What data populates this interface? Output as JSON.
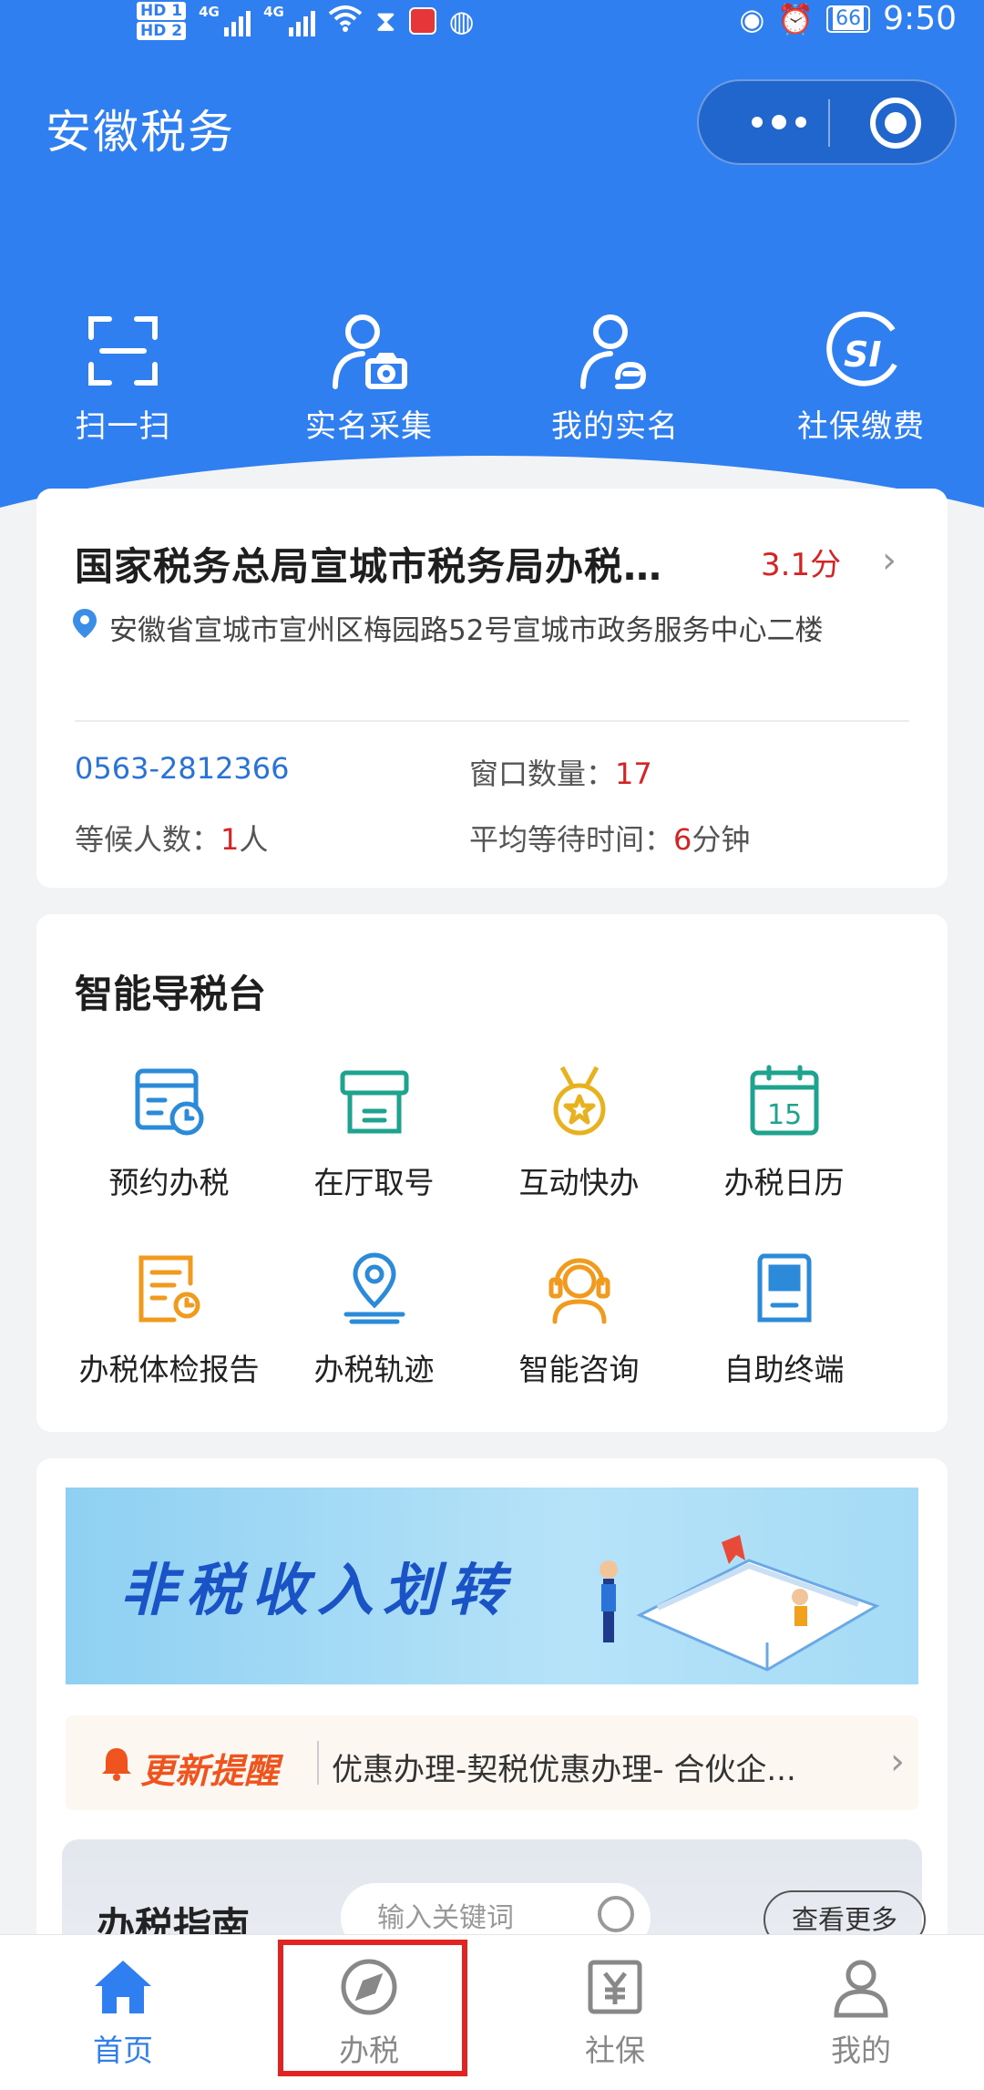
{
  "status_bar": {
    "hd1": "HD 1",
    "hd2": "HD 2",
    "net1": "4G",
    "net2": "4G",
    "battery": "66",
    "time": "9:50"
  },
  "header": {
    "title": "安徽税务"
  },
  "quick_actions": [
    {
      "label": "扫一扫",
      "icon": "scan-icon"
    },
    {
      "label": "实名采集",
      "icon": "user-camera-icon"
    },
    {
      "label": "我的实名",
      "icon": "user-id-icon"
    },
    {
      "label": "社保缴费",
      "icon": "social-security-icon"
    }
  ],
  "tax_office": {
    "name": "国家税务总局宣城市税务局办税…",
    "score": "3.1分",
    "address": "安徽省宣城市宣州区梅园路52号宣城市政务服务中心二楼",
    "phone": "0563-2812366",
    "window_label": "窗口数量：",
    "window_count": "17",
    "waiting_label": "等候人数：",
    "waiting_count": "1",
    "waiting_unit": "人",
    "avg_wait_label": "平均等待时间：",
    "avg_wait_value": "6",
    "avg_wait_unit": "分钟"
  },
  "smart_guide": {
    "title": "智能导税台",
    "items": [
      {
        "label": "预约办税",
        "icon": "calendar-clock-icon"
      },
      {
        "label": "在厅取号",
        "icon": "ticket-machine-icon"
      },
      {
        "label": "互动快办",
        "icon": "medal-icon"
      },
      {
        "label": "办税日历",
        "icon": "calendar-15-icon"
      },
      {
        "label": "办税体检报告",
        "icon": "report-icon"
      },
      {
        "label": "办税轨迹",
        "icon": "location-pin-icon"
      },
      {
        "label": "智能咨询",
        "icon": "headset-agent-icon"
      },
      {
        "label": "自助终端",
        "icon": "kiosk-icon"
      }
    ]
  },
  "banner": {
    "text": "非税收入划转"
  },
  "notice": {
    "tag": "更新提醒",
    "message": "优惠办理-契税优惠办理- 合伙企..."
  },
  "tax_guide": {
    "title": "办税指南",
    "search_placeholder": "输入关键词",
    "more": "查看更多"
  },
  "tabbar": [
    {
      "label": "首页",
      "icon": "home-icon",
      "active": true
    },
    {
      "label": "办税",
      "icon": "compass-icon",
      "active": false
    },
    {
      "label": "社保",
      "icon": "yuan-icon",
      "active": false
    },
    {
      "label": "我的",
      "icon": "user-icon",
      "active": false
    }
  ],
  "colors": {
    "primary": "#2f7ff0",
    "accent_red": "#d62424",
    "notice_orange": "#f0541e",
    "highlight_box": "#e32222"
  }
}
